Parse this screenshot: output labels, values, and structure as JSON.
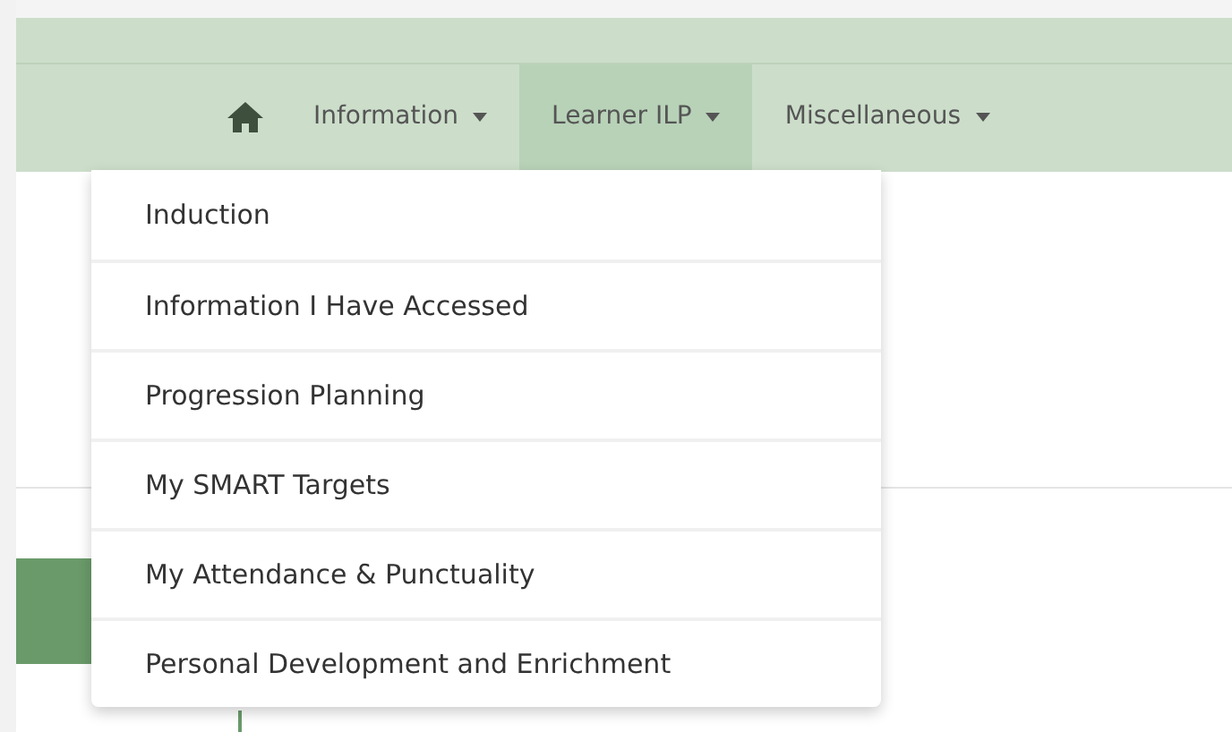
{
  "nav": {
    "items": [
      {
        "kind": "home",
        "selected": false
      },
      {
        "kind": "menu",
        "label": "Information",
        "selected": false
      },
      {
        "kind": "menu",
        "label": "Learner ILP",
        "selected": true
      },
      {
        "kind": "menu",
        "label": "Miscellaneous",
        "selected": false
      }
    ]
  },
  "dropdown": {
    "items": [
      "Induction",
      "Information I Have Accessed",
      "Progression Planning",
      "My SMART Targets",
      "My Attendance & Punctuality",
      "Personal Development and Enrichment"
    ]
  }
}
